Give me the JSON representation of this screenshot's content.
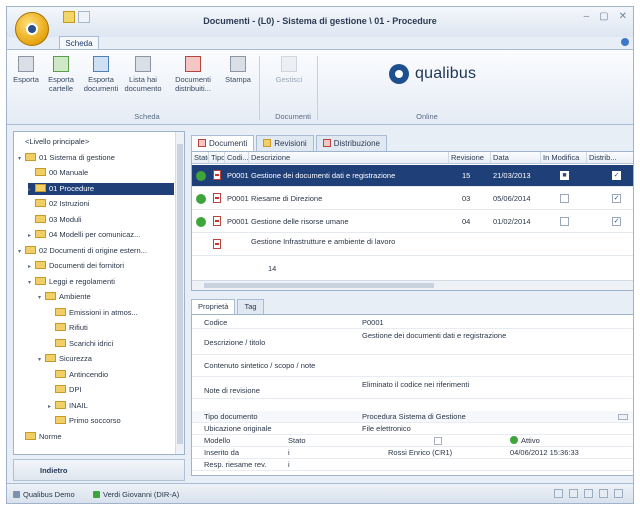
{
  "window": {
    "title": "Documenti - (L0) - Sistema di gestione \\ 01 - Procedure",
    "tab": "Scheda"
  },
  "ribbon": {
    "buttons": [
      {
        "label": "Esporta"
      },
      {
        "label": "Esporta cartelle"
      },
      {
        "label": "Esporta documenti"
      },
      {
        "label": "Lista hai documento"
      },
      {
        "label": "Documenti distribuiti..."
      },
      {
        "label": "Stampa"
      },
      {
        "label": "Gestisci"
      }
    ],
    "groups": [
      "Scheda",
      "Documenti",
      "Online"
    ],
    "logo": "qualibus"
  },
  "tree": {
    "items": [
      {
        "label": "<Livello principale>",
        "level": 0,
        "expander": "",
        "folder": false,
        "selected": false
      },
      {
        "label": "01 Sistema di gestione",
        "level": 0,
        "expander": "▾",
        "folder": true,
        "selected": false
      },
      {
        "label": "00 Manuale",
        "level": 1,
        "expander": "",
        "folder": true,
        "selected": false
      },
      {
        "label": "01 Procedure",
        "level": 1,
        "expander": "▸",
        "folder": true,
        "selected": true
      },
      {
        "label": "02 Istruzioni",
        "level": 1,
        "expander": "",
        "folder": true,
        "selected": false
      },
      {
        "label": "03 Moduli",
        "level": 1,
        "expander": "",
        "folder": true,
        "selected": false
      },
      {
        "label": "04 Modelli per comunicaz...",
        "level": 1,
        "expander": "▸",
        "folder": true,
        "selected": false
      },
      {
        "label": "02 Documenti di origine estern...",
        "level": 0,
        "expander": "▾",
        "folder": true,
        "selected": false
      },
      {
        "label": "Documenti dei fornitori",
        "level": 1,
        "expander": "▸",
        "folder": true,
        "selected": false
      },
      {
        "label": "Leggi e regolamenti",
        "level": 1,
        "expander": "▾",
        "folder": true,
        "selected": false
      },
      {
        "label": "Ambiente",
        "level": 2,
        "expander": "▾",
        "folder": true,
        "selected": false
      },
      {
        "label": "Emissioni in atmos...",
        "level": 3,
        "expander": "",
        "folder": true,
        "selected": false
      },
      {
        "label": "Rifiuti",
        "level": 3,
        "expander": "",
        "folder": true,
        "selected": false
      },
      {
        "label": "Scarichi idrici",
        "level": 3,
        "expander": "",
        "folder": true,
        "selected": false
      },
      {
        "label": "Sicurezza",
        "level": 2,
        "expander": "▾",
        "folder": true,
        "selected": false
      },
      {
        "label": "Antincendio",
        "level": 3,
        "expander": "",
        "folder": true,
        "selected": false
      },
      {
        "label": "DPI",
        "level": 3,
        "expander": "",
        "folder": true,
        "selected": false
      },
      {
        "label": "INAIL",
        "level": 3,
        "expander": "▸",
        "folder": true,
        "selected": false
      },
      {
        "label": "Primo soccorso",
        "level": 3,
        "expander": "",
        "folder": true,
        "selected": false
      },
      {
        "label": "Norme",
        "level": 0,
        "expander": "",
        "folder": true,
        "selected": false
      }
    ]
  },
  "nav_footer": "Indietro",
  "doc_tabs": [
    {
      "label": "Documenti",
      "active": true
    },
    {
      "label": "Revisioni",
      "active": false
    },
    {
      "label": "Distribuzione",
      "active": false
    }
  ],
  "grid": {
    "columns": [
      "Stato",
      "Tipo",
      "Codi...",
      "Descrizione",
      "Revisione",
      "Data",
      "In Modifica",
      "Distrib..."
    ],
    "rows": [
      {
        "code": "P0001",
        "description": "Gestione dei documenti dati e registrazione",
        "revision": "15",
        "date": "21/03/2013",
        "in_modifica": "■",
        "distrib": "✓",
        "selected": true
      },
      {
        "code": "P0001",
        "description": "Riesame di Direzione",
        "revision": "03",
        "date": "05/06/2014",
        "in_modifica": "",
        "distrib": "✓",
        "selected": false
      },
      {
        "code": "P0001",
        "description": "Gestione delle risorse umane",
        "revision": "04",
        "date": "01/02/2014",
        "in_modifica": "",
        "distrib": "✓",
        "selected": false
      },
      {
        "code": "",
        "description": "Gestione Infrastrutture e ambiente di lavoro",
        "revision": "",
        "date": "",
        "in_modifica": "",
        "distrib": "",
        "selected": false
      }
    ],
    "count": "14"
  },
  "prop_tabs": [
    {
      "label": "Proprietà",
      "active": true
    },
    {
      "label": "Tag",
      "active": false
    }
  ],
  "properties": {
    "code_label": "Codice",
    "code_value": "P0001",
    "desc_label": "Descrizione / titolo",
    "desc_value": "Gestione dei documenti dati e registrazione",
    "content_label": "Contenuto sintetico / scopo / note",
    "notes_label": "Note di revisione",
    "notes_value": "Eliminato il codice nei riferimenti",
    "type_label": "Tipo documento",
    "type_value": "Procedura Sistema di Gestione",
    "location_label": "Ubicazione originale",
    "location_value": "File elettronico",
    "model_label": "Modello",
    "state_label": "Stato",
    "state_value": "Attivo",
    "inserted_label": "Inserito da",
    "inserted_by": "Rossi Enrico (CR1)",
    "inserted_date": "04/06/2012 15:36:33",
    "reviewer_label": "Resp. riesame rev.",
    "row_marker": "i"
  },
  "statusbar": {
    "app": "Qualibus Demo",
    "user": "Verdi Giovanni (DIR-A)"
  }
}
